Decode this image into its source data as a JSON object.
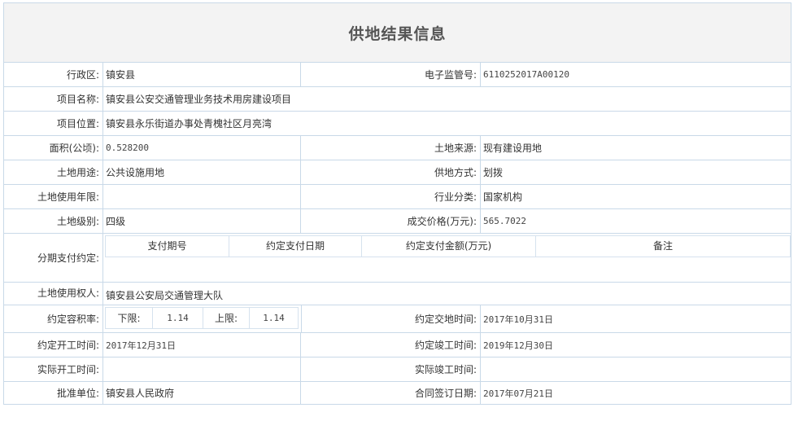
{
  "title": "供地结果信息",
  "labels": {
    "district": "行政区:",
    "monitor_no": "电子监管号:",
    "project_name": "项目名称:",
    "project_location": "项目位置:",
    "area": "面积(公顷):",
    "land_source": "土地来源:",
    "land_use": "土地用途:",
    "supply_method": "供地方式:",
    "use_years": "土地使用年限:",
    "industry": "行业分类:",
    "land_grade": "土地级别:",
    "price": "成交价格(万元):",
    "installment": "分期支付约定:",
    "right_holder": "土地使用权人:",
    "far": "约定容积率:",
    "delivery_time": "约定交地时间:",
    "start_time": "约定开工时间:",
    "finish_time": "约定竣工时间:",
    "actual_start": "实际开工时间:",
    "actual_finish": "实际竣工时间:",
    "approver": "批准单位:",
    "contract_date": "合同签订日期:"
  },
  "values": {
    "district": "镇安县",
    "monitor_no": "6110252017A00120",
    "project_name": "镇安县公安交通管理业务技术用房建设项目",
    "project_location": "镇安县永乐街道办事处青槐社区月亮湾",
    "area": "0.528200",
    "land_source": "现有建设用地",
    "land_use": "公共设施用地",
    "supply_method": "划拨",
    "use_years": "",
    "industry": "国家机构",
    "land_grade": "四级",
    "price": "565.7022",
    "right_holder": "镇安县公安局交通管理大队",
    "delivery_time": "2017年10月31日",
    "start_time": "2017年12月31日",
    "finish_time": "2019年12月30日",
    "actual_start": "",
    "actual_finish": "",
    "approver": "镇安县人民政府",
    "contract_date": "2017年07月21日"
  },
  "installment_table": {
    "headers": [
      "支付期号",
      "约定支付日期",
      "约定支付金额(万元)",
      "备注"
    ]
  },
  "far": {
    "lower_label": "下限:",
    "lower_value": "1.14",
    "upper_label": "上限:",
    "upper_value": "1.14"
  },
  "colors": {
    "border": "#c9d9e8",
    "title_bg": "#f3f3f3"
  }
}
